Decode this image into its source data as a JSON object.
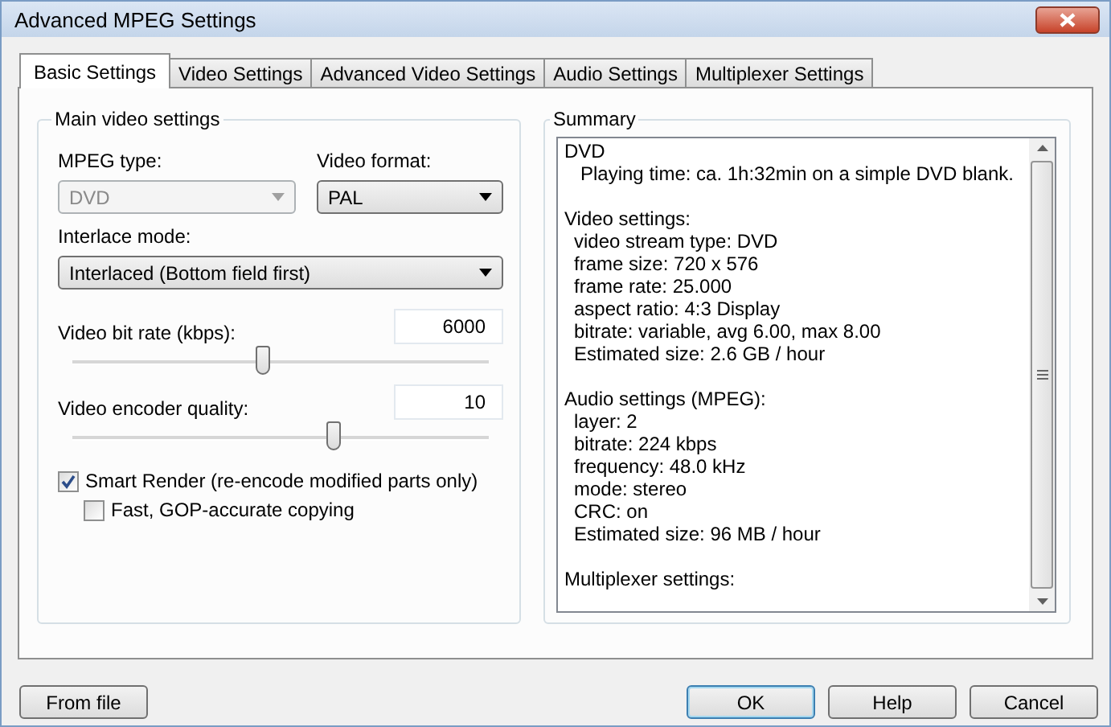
{
  "window": {
    "title": "Advanced MPEG Settings"
  },
  "tabs": [
    {
      "label": "Basic Settings",
      "selected": true
    },
    {
      "label": "Video Settings",
      "selected": false
    },
    {
      "label": "Advanced Video Settings",
      "selected": false
    },
    {
      "label": "Audio Settings",
      "selected": false
    },
    {
      "label": "Multiplexer Settings",
      "selected": false
    }
  ],
  "main_video_settings": {
    "title": "Main video settings",
    "mpeg_type": {
      "label": "MPEG type:",
      "value": "DVD",
      "disabled": true
    },
    "video_format": {
      "label": "Video format:",
      "value": "PAL",
      "disabled": false
    },
    "interlace_mode": {
      "label": "Interlace mode:",
      "value": "Interlaced (Bottom field first)",
      "disabled": false
    },
    "sliders": [
      {
        "label": "Video bit rate (kbps):",
        "value": "6000",
        "level": 0.46
      },
      {
        "label": "Video encoder quality:",
        "value": "10",
        "level": 0.63
      }
    ],
    "checkboxes": [
      {
        "label": "Smart Render (re-encode modified parts only)",
        "checked": true,
        "nested": false
      },
      {
        "label": "Fast, GOP-accurate copying",
        "checked": false,
        "nested": true
      }
    ]
  },
  "summary": {
    "title": "Summary",
    "sections": [
      {
        "heading": "DVD",
        "lines": [
          "Playing time: ca. 1h:32min on a simple DVD blank."
        ]
      },
      {
        "heading": "Video settings:",
        "lines": [
          "video stream type: DVD",
          "frame size: 720 x 576",
          "frame rate: 25.000",
          "aspect ratio: 4:3 Display",
          "bitrate: variable, avg 6.00, max 8.00",
          "Estimated size: 2.6 GB / hour"
        ]
      },
      {
        "heading": "Audio settings (MPEG):",
        "lines": [
          "layer: 2",
          "bitrate: 224 kbps",
          "frequency: 48.0 kHz",
          "mode: stereo",
          "CRC: on",
          "Estimated size: 96 MB / hour"
        ]
      },
      {
        "heading": "Multiplexer settings:"
      }
    ]
  },
  "buttons_left": [
    {
      "label": "From file",
      "default": false
    }
  ],
  "buttons_right": [
    {
      "label": "OK",
      "default": true
    },
    {
      "label": "Help",
      "default": false
    },
    {
      "label": "Cancel",
      "default": false
    }
  ]
}
